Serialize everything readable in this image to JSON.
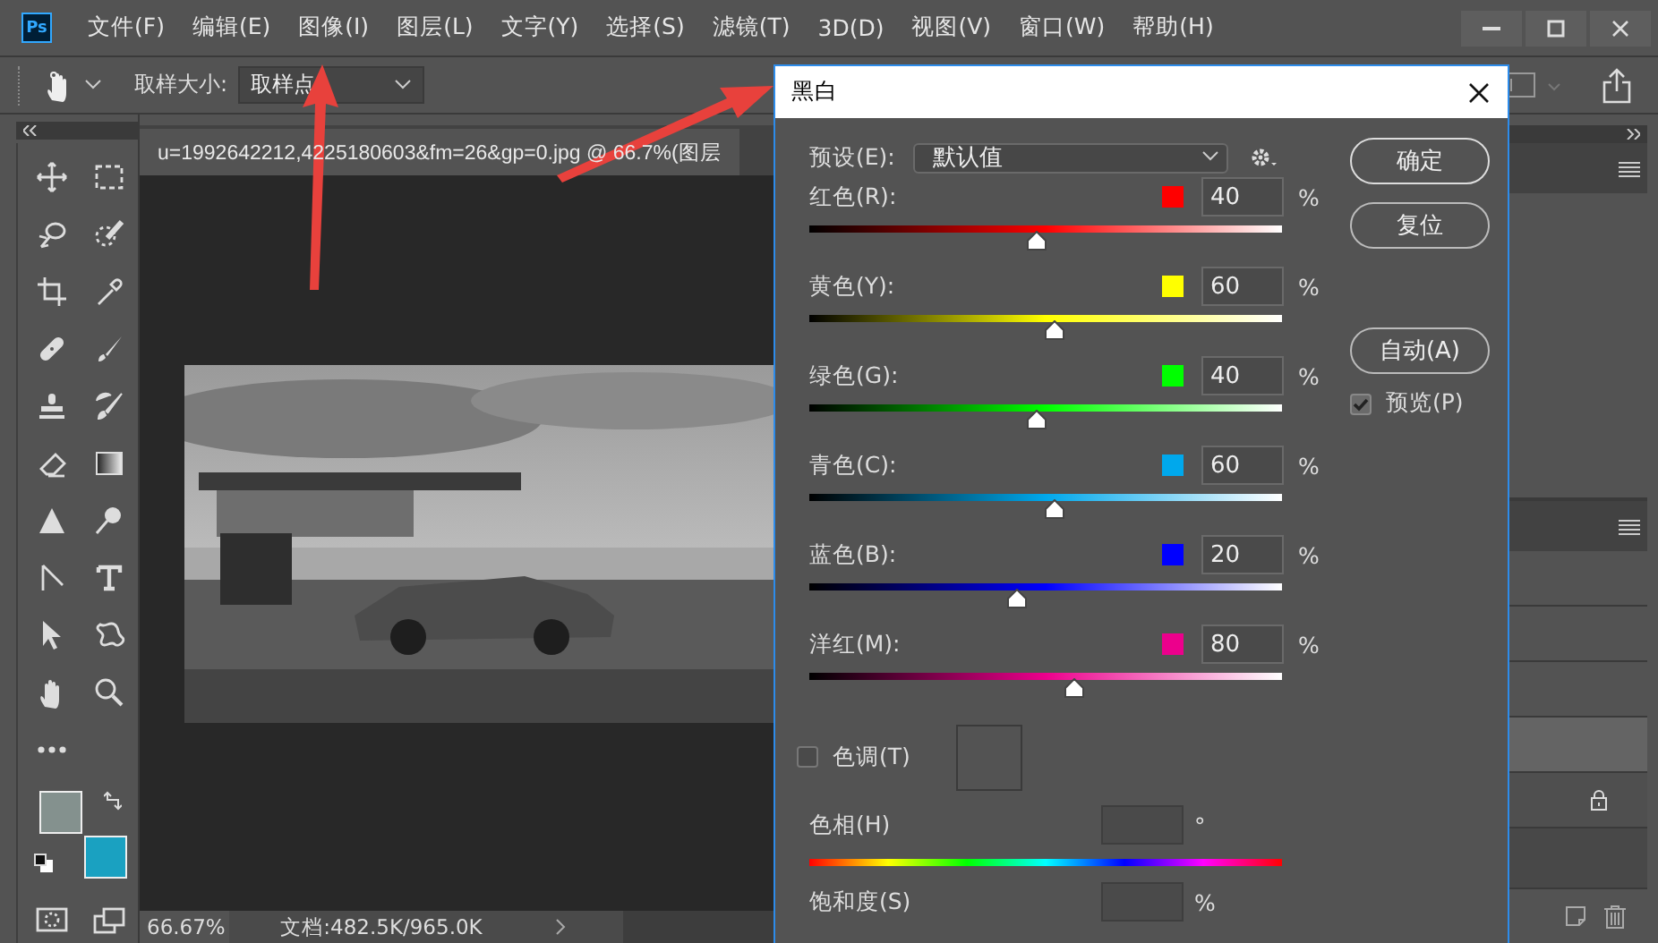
{
  "menu_bar": {
    "logo": "Ps",
    "items": [
      "文件(F)",
      "编辑(E)",
      "图像(I)",
      "图层(L)",
      "文字(Y)",
      "选择(S)",
      "滤镜(T)",
      "3D(D)",
      "视图(V)",
      "窗口(W)",
      "帮助(H)"
    ]
  },
  "options_bar": {
    "sample_size_label": "取样大小:",
    "sample_size_value": "取样点"
  },
  "document": {
    "tab_title": "u=1992642212,4225180603&fm=26&gp=0.jpg @ 66.7%(图层",
    "zoom": "66.67%",
    "doc_info": "文档:482.5K/965.0K"
  },
  "color_swatches": [
    {
      "kind": "foreground",
      "color": "#84918e"
    },
    {
      "kind": "background",
      "color": "#1aa1c1"
    }
  ],
  "dialog": {
    "title": "黑白",
    "preset_label": "预设(E):",
    "preset_value": "默认值",
    "buttons": [
      "确定",
      "复位",
      "自动(A)"
    ],
    "preview": {
      "label": "预览(P)",
      "checked": true
    },
    "channels": [
      {
        "label": "红色(R):",
        "color": "#ff0000",
        "value": "40",
        "unit": "%",
        "level": 0.48
      },
      {
        "label": "黄色(Y):",
        "color": "#ffff00",
        "value": "60",
        "unit": "%",
        "level": 0.52
      },
      {
        "label": "绿色(G):",
        "color": "#00ff00",
        "value": "40",
        "unit": "%",
        "level": 0.48
      },
      {
        "label": "青色(C):",
        "color": "#00a8ec",
        "value": "60",
        "unit": "%",
        "level": 0.52
      },
      {
        "label": "蓝色(B):",
        "color": "#0000ff",
        "value": "20",
        "unit": "%",
        "level": 0.44
      },
      {
        "label": "洋红(M):",
        "color": "#ec008c",
        "value": "80",
        "unit": "%",
        "level": 0.56
      }
    ],
    "tint": {
      "label": "色调(T)",
      "checked": false
    },
    "hue": {
      "label": "色相(H)",
      "unit": "°"
    },
    "saturation": {
      "label": "饱和度(S)",
      "unit": "%"
    }
  }
}
